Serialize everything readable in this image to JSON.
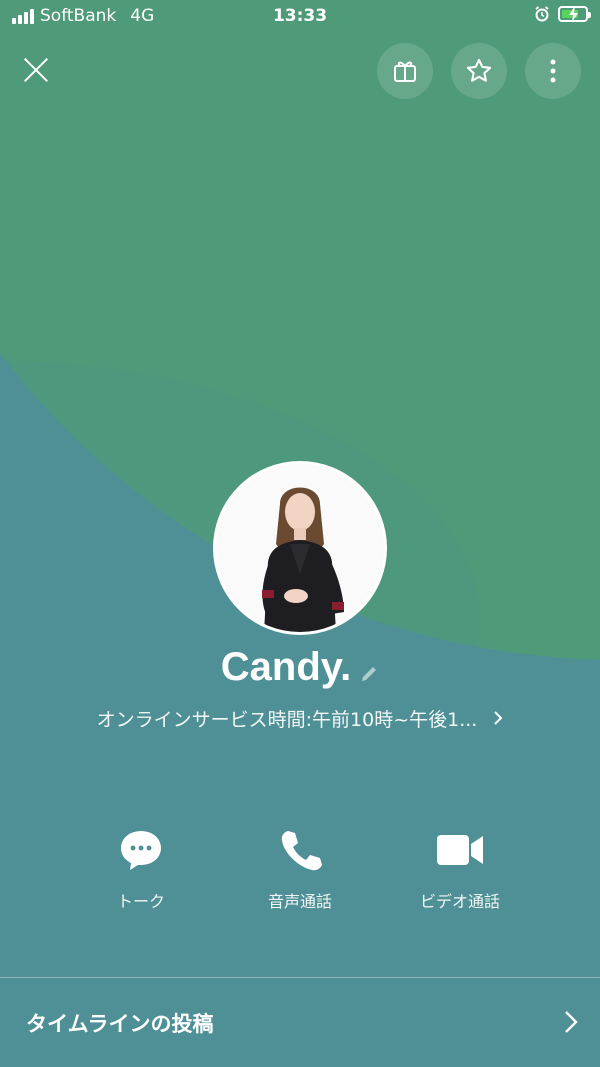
{
  "status_bar": {
    "carrier": "SoftBank",
    "network": "4G",
    "time": "13:33"
  },
  "header": {
    "close_icon": "close-icon",
    "buttons": [
      "gift-icon",
      "star-icon",
      "more-vertical-icon"
    ]
  },
  "profile": {
    "name": "Candy.",
    "status_message": "オンラインサービス時間:午前10時~午後1...",
    "background_colors": {
      "top": "#4f9a79",
      "bottom": "#4f8f96"
    }
  },
  "actions": [
    {
      "label": "トーク",
      "icon": "chat-bubble-icon"
    },
    {
      "label": "音声通話",
      "icon": "phone-icon"
    },
    {
      "label": "ビデオ通話",
      "icon": "video-camera-icon"
    }
  ],
  "timeline": {
    "label": "タイムラインの投稿"
  }
}
